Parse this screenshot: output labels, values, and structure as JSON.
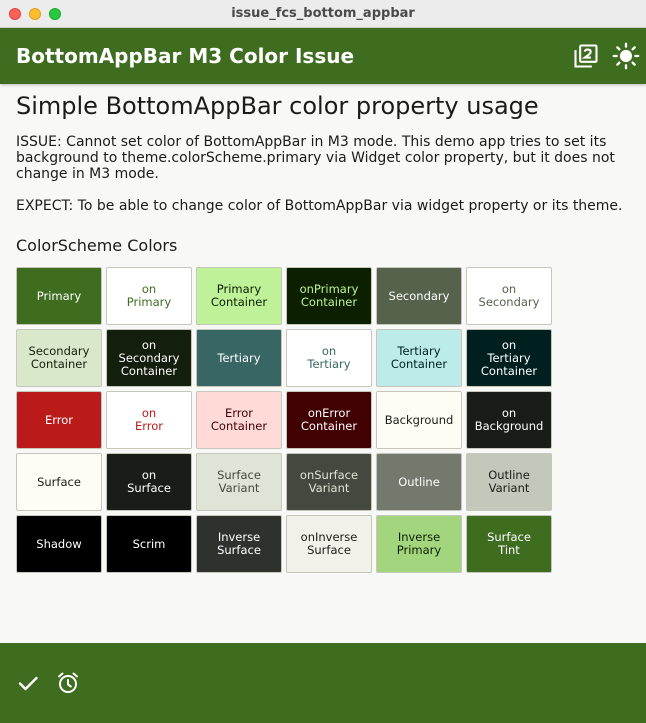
{
  "window": {
    "title": "issue_fcs_bottom_appbar"
  },
  "appbar": {
    "title": "BottomAppBar M3 Color Issue",
    "icons": [
      "filter-2-icon",
      "sun-icon"
    ],
    "color": "#3f6d20"
  },
  "main": {
    "heading": "Simple BottomAppBar color property usage",
    "issue": "ISSUE: Cannot set color of BottomAppBar in M3 mode. This demo app tries to set its background to theme.colorScheme.primary via Widget color property, but it does not change in M3 mode.",
    "expect": "EXPECT: To be able to change color of BottomAppBar via widget property or its theme.",
    "section_title": "ColorScheme Colors"
  },
  "colors": [
    {
      "label": "Primary",
      "bg": "#3f6d20",
      "fg": "#ffffff"
    },
    {
      "label": "on\nPrimary",
      "bg": "#ffffff",
      "fg": "#3f6d20"
    },
    {
      "label": "Primary\nContainer",
      "bg": "#bef198",
      "fg": "#0c2000"
    },
    {
      "label": "onPrimary\nContainer",
      "bg": "#0c2000",
      "fg": "#bef198"
    },
    {
      "label": "Secondary",
      "bg": "#56624b",
      "fg": "#ffffff"
    },
    {
      "label": "on\nSecondary",
      "bg": "#ffffff",
      "fg": "#56624b"
    },
    {
      "label": "Secondary\nContainer",
      "bg": "#d9e7ca",
      "fg": "#141e0c"
    },
    {
      "label": "on\nSecondary\nContainer",
      "bg": "#141e0c",
      "fg": "#ffffff"
    },
    {
      "label": "Tertiary",
      "bg": "#386664",
      "fg": "#ffffff"
    },
    {
      "label": "on\nTertiary",
      "bg": "#ffffff",
      "fg": "#386664"
    },
    {
      "label": "Tertiary\nContainer",
      "bg": "#bbece9",
      "fg": "#00201f"
    },
    {
      "label": "on\nTertiary\nContainer",
      "bg": "#00201f",
      "fg": "#ffffff"
    },
    {
      "label": "Error",
      "bg": "#ba1a1a",
      "fg": "#ffffff"
    },
    {
      "label": "on\nError",
      "bg": "#ffffff",
      "fg": "#ba1a1a"
    },
    {
      "label": "Error\nContainer",
      "bg": "#ffdad6",
      "fg": "#410002"
    },
    {
      "label": "onError\nContainer",
      "bg": "#410002",
      "fg": "#ffffff"
    },
    {
      "label": "Background",
      "bg": "#fdfdf5",
      "fg": "#1a1c18"
    },
    {
      "label": "on\nBackground",
      "bg": "#1a1c18",
      "fg": "#ffffff"
    },
    {
      "label": "Surface",
      "bg": "#fdfdf5",
      "fg": "#1a1c18"
    },
    {
      "label": "on\nSurface",
      "bg": "#1a1c18",
      "fg": "#ffffff"
    },
    {
      "label": "Surface\nVariant",
      "bg": "#e0e4d6",
      "fg": "#44483e"
    },
    {
      "label": "onSurface\nVariant",
      "bg": "#44483e",
      "fg": "#e0e4d6"
    },
    {
      "label": "Outline",
      "bg": "#74796d",
      "fg": "#ffffff"
    },
    {
      "label": "Outline\nVariant",
      "bg": "#c4c8bb",
      "fg": "#1a1c18"
    },
    {
      "label": "Shadow",
      "bg": "#000000",
      "fg": "#ffffff"
    },
    {
      "label": "Scrim",
      "bg": "#000000",
      "fg": "#ffffff"
    },
    {
      "label": "Inverse\nSurface",
      "bg": "#2f312d",
      "fg": "#ffffff"
    },
    {
      "label": "onInverse\nSurface",
      "bg": "#f1f1ea",
      "fg": "#1a1c18"
    },
    {
      "label": "Inverse\nPrimary",
      "bg": "#a3d57f",
      "fg": "#0c2000"
    },
    {
      "label": "Surface\nTint",
      "bg": "#3f6d20",
      "fg": "#ffffff"
    }
  ],
  "bottombar": {
    "icons": [
      "check-icon",
      "alarm-icon"
    ],
    "color": "#3f6d20"
  }
}
